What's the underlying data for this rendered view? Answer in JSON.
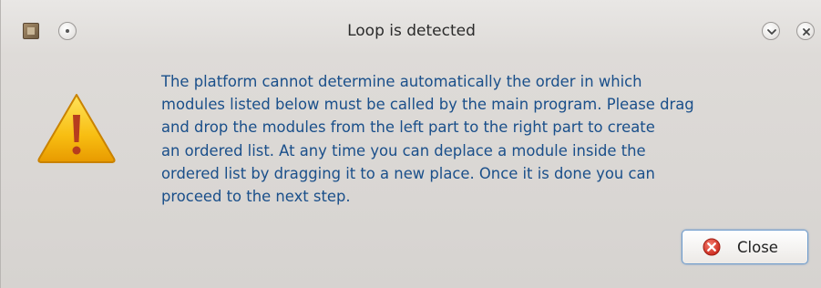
{
  "window": {
    "title": "Loop is detected"
  },
  "message": {
    "text": "The platform cannot determine automatically the order in which\nmodules listed below must be called by the main program. Please drag\nand drop the modules from the left part to the right part  to create\nan ordered list.  At any time you can deplace a module inside the\nordered list by dragging it to a new place.  Once it is done you can\nproceed to the next step."
  },
  "buttons": {
    "close_label": "Close"
  },
  "icons": {
    "app": "app-icon",
    "window_menu": "circle-menu-icon",
    "minimize": "chevron-down-icon",
    "close_window": "close-icon",
    "warning": "warning-icon",
    "close_button": "close-circle-icon"
  },
  "colors": {
    "message_text": "#1a4f8a",
    "warning_fill": "#f5b400",
    "close_icon_fill": "#d9362b"
  }
}
